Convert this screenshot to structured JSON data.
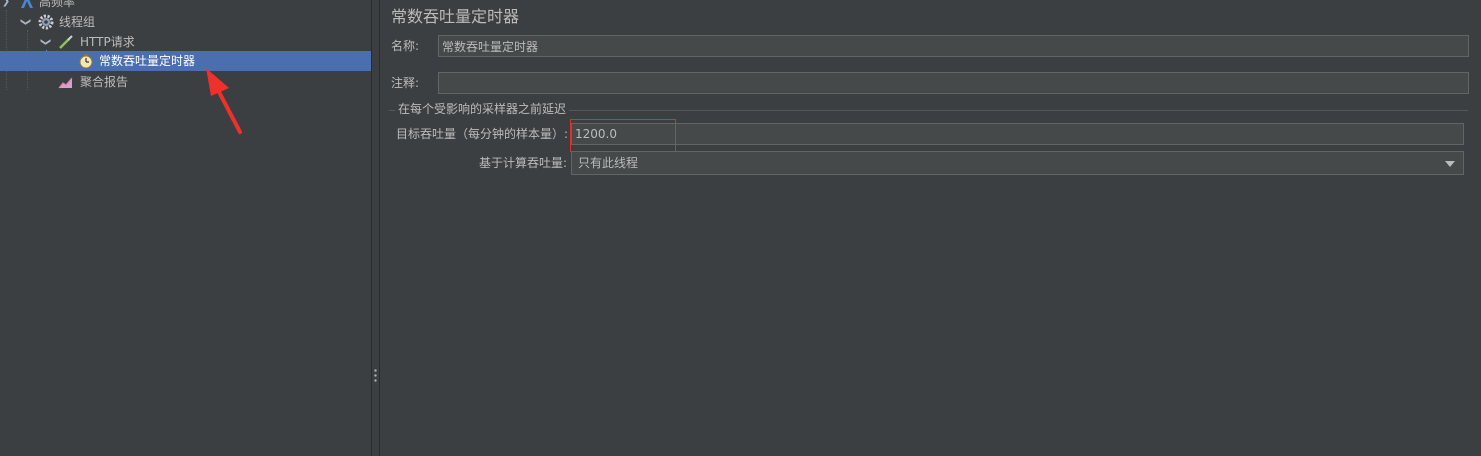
{
  "tree": {
    "items": [
      {
        "label": "高频率",
        "icon": "test-plan-icon",
        "expanded": true
      },
      {
        "label": "线程组",
        "icon": "thread-group-gear-icon",
        "expanded": true
      },
      {
        "label": "HTTP请求",
        "icon": "http-sampler-pipette-icon",
        "expanded": true
      },
      {
        "label": "常数吞吐量定时器",
        "icon": "timer-stopwatch-icon",
        "selected": true
      },
      {
        "label": "聚合报告",
        "icon": "aggregate-report-chart-icon"
      }
    ]
  },
  "panel": {
    "title": "常数吞吐量定时器",
    "name_label": "名称:",
    "name_value": "常数吞吐量定时器",
    "comment_label": "注释:",
    "comment_value": "",
    "section_title": "在每个受影响的采样器之前延迟",
    "throughput_label": "目标吞吐量（每分钟的样本量）:",
    "throughput_value": "1200.0",
    "calc_label": "基于计算吞吐量:",
    "calc_value": "只有此线程"
  },
  "colors": {
    "background": "#3c3f41",
    "selection": "#4b6eaf",
    "field_bg": "#45494a",
    "text": "#bbbbbb",
    "highlight_box": "#e0302a",
    "annotation_arrow": "#f0302a"
  }
}
